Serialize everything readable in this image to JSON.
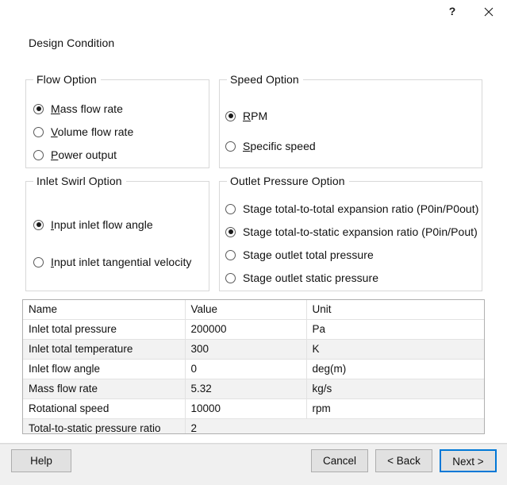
{
  "window": {
    "heading": "Design Condition",
    "titlebar": {
      "help_glyph": "?",
      "help_name": "help-icon",
      "close_name": "close-icon"
    }
  },
  "colors": {
    "accent": "#0078d7",
    "button_face": "#e1e1e1",
    "button_border": "#adadad",
    "footer_bg": "#f0f0f0",
    "group_border": "#d8d8d8",
    "grid_border": "#b0b0b0",
    "grid_line": "#e2e2e2",
    "row_alt": "#f2f2f2",
    "text": "#111111"
  },
  "groups": {
    "flow": {
      "legend": "Flow Option",
      "options": [
        {
          "mnemonic": "M",
          "rest": "ass flow rate",
          "checked": true
        },
        {
          "mnemonic": "V",
          "rest": "olume flow rate",
          "checked": false
        },
        {
          "mnemonic": "P",
          "rest": "ower output",
          "checked": false
        }
      ]
    },
    "speed": {
      "legend": "Speed Option",
      "options": [
        {
          "mnemonic": "R",
          "rest": "PM",
          "checked": true
        },
        {
          "mnemonic": "S",
          "rest": "pecific speed",
          "checked": false
        }
      ]
    },
    "swirl": {
      "legend": "Inlet Swirl Option",
      "options": [
        {
          "mnemonic": "I",
          "rest": "nput inlet flow angle",
          "checked": true
        },
        {
          "mnemonic": "I",
          "rest": "nput inlet tangential velocity",
          "checked": false
        }
      ]
    },
    "outlet": {
      "legend": "Outlet Pressure Option",
      "options": [
        {
          "mnemonic": "",
          "rest": "Stage total-to-total expansion ratio (P0in/P0out)",
          "checked": false
        },
        {
          "mnemonic": "",
          "rest": "Stage total-to-static expansion ratio (P0in/Pout)",
          "checked": true
        },
        {
          "mnemonic": "",
          "rest": "Stage outlet total pressure",
          "checked": false
        },
        {
          "mnemonic": "",
          "rest": "Stage outlet static pressure",
          "checked": false
        }
      ]
    }
  },
  "grid": {
    "columns": [
      "Name",
      "Value",
      "Unit"
    ],
    "rows": [
      {
        "name": "Inlet total pressure",
        "value": "200000",
        "unit": "Pa"
      },
      {
        "name": "Inlet total temperature",
        "value": "300",
        "unit": "K"
      },
      {
        "name": "Inlet flow angle",
        "value": "0",
        "unit": "deg(m)"
      },
      {
        "name": "Mass flow rate",
        "value": "5.32",
        "unit": "kg/s"
      },
      {
        "name": "Rotational speed",
        "value": "10000",
        "unit": "rpm"
      },
      {
        "name": "Total-to-static pressure ratio",
        "value": "2",
        "unit": ""
      }
    ]
  },
  "footer": {
    "help": "Help",
    "cancel": "Cancel",
    "back": "< Back",
    "next": "Next >"
  }
}
